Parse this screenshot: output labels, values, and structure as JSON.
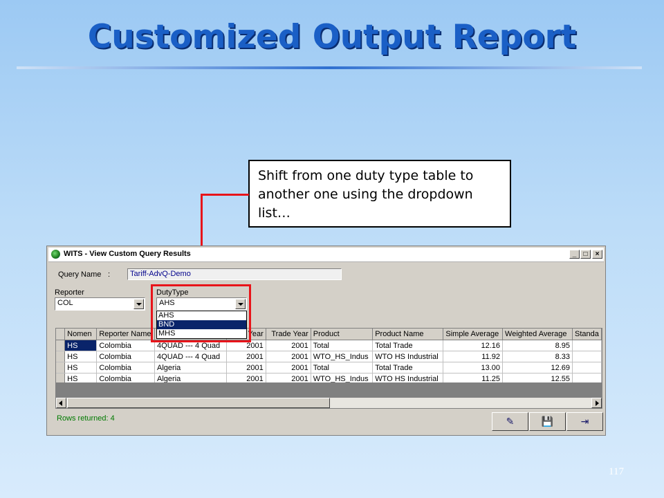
{
  "slide": {
    "title": "Customized Output Report",
    "callout": "Shift from one duty type table to another one using the dropdown list…",
    "page_number": "117"
  },
  "window": {
    "title": "WITS - View Custom Query Results",
    "controls": [
      "_",
      "□",
      "×"
    ]
  },
  "query": {
    "label": "Query Name",
    "colon": ":",
    "value": "Tariff-AdvQ-Demo"
  },
  "reporter": {
    "label": "Reporter",
    "value": "COL"
  },
  "duty_type": {
    "label": "DutyType",
    "value": "AHS",
    "options": [
      "AHS",
      "BND",
      "MHS"
    ],
    "highlighted": "BND"
  },
  "grid": {
    "columns": [
      "Nomen",
      "Reporter Name",
      "",
      "ff Year",
      "Trade Year",
      "Product",
      "Product Name",
      "Simple Average",
      "Weighted Average",
      "Standa"
    ],
    "rows": [
      [
        "HS",
        "Colombia",
        "4QUAD --- 4 Quad",
        "2001",
        "2001",
        "Total",
        "Total Trade",
        "12.16",
        "8.95"
      ],
      [
        "HS",
        "Colombia",
        "4QUAD --- 4 Quad",
        "2001",
        "2001",
        "WTO_HS_Indus",
        "WTO HS Industrial",
        "11.92",
        "8.33"
      ],
      [
        "HS",
        "Colombia",
        "Algeria",
        "2001",
        "2001",
        "Total",
        "Total Trade",
        "13.00",
        "12.69"
      ],
      [
        "HS",
        "Colombia",
        "Algeria",
        "2001",
        "2001",
        "WTO_HS_Indus",
        "WTO HS Industrial",
        "11.25",
        "12.55"
      ]
    ]
  },
  "status": {
    "text": "Rows returned: 4"
  },
  "toolbar": {
    "icons": [
      "edit-report-icon",
      "save-disk-icon",
      "exit-door-icon"
    ],
    "glyphs": {
      "edit": "✎",
      "save": "💾",
      "exit": "⇥"
    }
  },
  "colors": {
    "accent_red": "#e8141a",
    "selection": "#0a246a",
    "title_blue": "#1a5fc6"
  }
}
